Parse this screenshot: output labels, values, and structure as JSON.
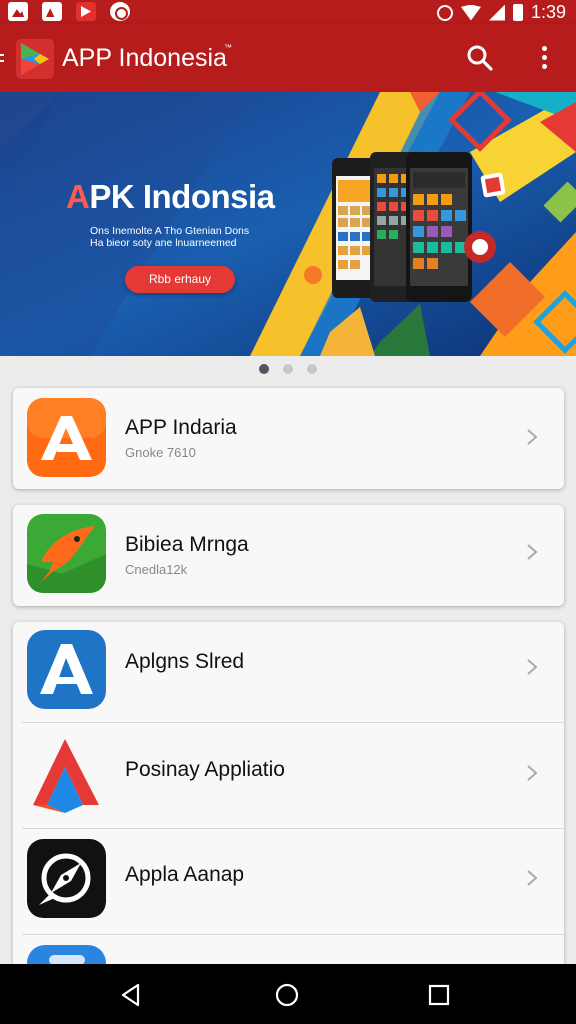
{
  "status_bar": {
    "time": "1:39"
  },
  "app_bar": {
    "title": "APP Indonesia",
    "trademark": "™"
  },
  "banner": {
    "title_accent": "A",
    "title_rest": "PK Indonsia",
    "subtitle_line1": "Ons Inemolte A Tho Gtenian Dons",
    "subtitle_line2": "Ha bieor soty ane lnuarneemed",
    "cta": "Rbb erhauy",
    "active_slide": 1,
    "slide_count": 3
  },
  "apps": [
    {
      "name": "APP Indaria",
      "meta": "Gnoke 7610",
      "icon": "orange-a-logo-icon"
    },
    {
      "name": "Bibiea Mrnga",
      "meta": "Cnedla12k",
      "icon": "green-bird-logo-icon"
    },
    {
      "name": "Aplgns Slred",
      "meta": "",
      "icon": "blue-a-logo-icon"
    },
    {
      "name": "Posinay Appliatio",
      "meta": "",
      "icon": "red-blue-a-logo-icon"
    },
    {
      "name": "Appla Aanap",
      "meta": "",
      "icon": "compass-logo-icon"
    },
    {
      "name": "",
      "meta": "",
      "icon": "blue-app-logo-icon"
    }
  ],
  "colors": {
    "brand": "#b71c1c",
    "cta": "#e53935",
    "background": "#ececec"
  },
  "nav_bar": {
    "icons": [
      "back-icon",
      "home-icon",
      "recents-icon"
    ]
  }
}
